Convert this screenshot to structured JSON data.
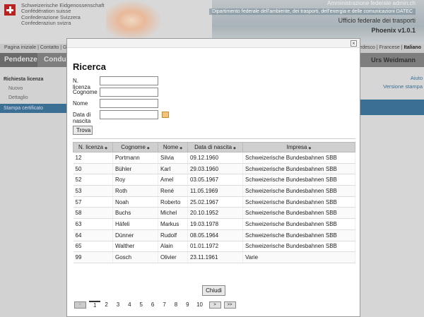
{
  "background": {
    "confederation": [
      "Schweizerische Eidgenossenschaft",
      "Confédération suisse",
      "Confederazione Svizzera",
      "Confederaziun svizra"
    ],
    "admin_label": "Amministrazione federale admin.ch",
    "department": "Dipartimento federale dell'ambiente, dei trasporti, dell'energia e delle comunicazioni DATEC",
    "office": "Ufficio federale dei trasporti",
    "app_version": "Phoenix v1.0.1",
    "top_links_left": "Pagina iniziale | Contatto | G",
    "top_links_right_prefix": "Tedesco | Francese | ",
    "top_links_right_active": "Italiano",
    "nav_tabs": [
      "Pendenze",
      "Condu"
    ],
    "user_name": "Urs Weidmann",
    "sidebar": {
      "heading": "Richiesta licenza",
      "items": [
        "Nuovo",
        "Dettaglio"
      ],
      "active": "Stampa certificato"
    },
    "right_links": [
      "Aiuto",
      "Versione stampa"
    ]
  },
  "modal": {
    "close_symbol": "×",
    "title": "Ricerca",
    "form": {
      "license_label": "N. licenza",
      "surname_label": "Cognome",
      "name_label": "Nome",
      "birthdate_label_1": "Data di",
      "birthdate_label_2": "nascita",
      "license_value": "",
      "surname_value": "",
      "name_value": "",
      "birthdate_value": "",
      "search_button": "Trova"
    },
    "table": {
      "columns": [
        "N. licenza",
        "Cognome",
        "Nome",
        "Data di nascita",
        "Impresa"
      ],
      "sort_symbol": "◆",
      "rows": [
        [
          "12",
          "Portmann",
          "Silvia",
          "09.12.1960",
          "Schweizerische Bundesbahnen SBB"
        ],
        [
          "50",
          "Bühler",
          "Karl",
          "29.03.1960",
          "Schweizerische Bundesbahnen SBB"
        ],
        [
          "52",
          "Roy",
          "Amel",
          "03.05.1967",
          "Schweizerische Bundesbahnen SBB"
        ],
        [
          "53",
          "Roth",
          "René",
          "11.05.1969",
          "Schweizerische Bundesbahnen SBB"
        ],
        [
          "57",
          "Noah",
          "Roberto",
          "25.02.1967",
          "Schweizerische Bundesbahnen SBB"
        ],
        [
          "58",
          "Buchs",
          "Michel",
          "20.10.1952",
          "Schweizerische Bundesbahnen SBB"
        ],
        [
          "63",
          "Häfeli",
          "Markus",
          "19.03.1978",
          "Schweizerische Bundesbahnen SBB"
        ],
        [
          "64",
          "Dünner",
          "Rudolf",
          "08.05.1964",
          "Schweizerische Bundesbahnen SBB"
        ],
        [
          "65",
          "Walther",
          "Alain",
          "01.01.1972",
          "Schweizerische Bundesbahnen SBB"
        ],
        [
          "99",
          "Gosch",
          "Olivier",
          "23.11.1961",
          "Varie"
        ]
      ]
    },
    "pager": {
      "prev": "<",
      "pages": [
        "1",
        "2",
        "3",
        "4",
        "5",
        "6",
        "7",
        "8",
        "9",
        "10"
      ],
      "current_page": "1",
      "next": ">",
      "last": ">>"
    },
    "close_button": "Chiudi"
  }
}
